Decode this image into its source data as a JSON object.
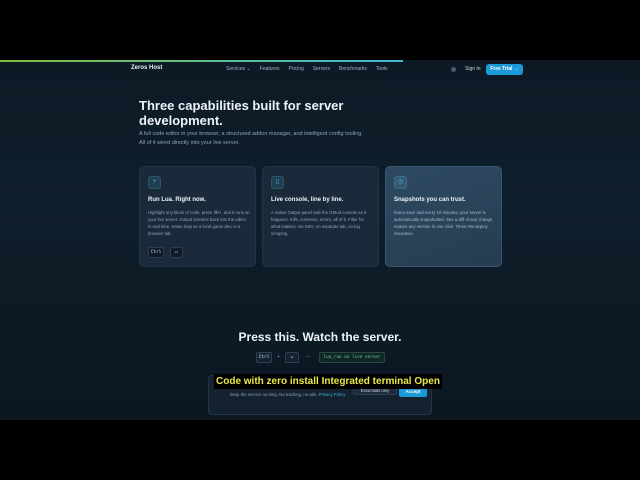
{
  "nav": {
    "logo": "Zeros Host",
    "menu": [
      "Services ⌄",
      "Features",
      "Pricing",
      "Servers",
      "Benchmarks",
      "Tools"
    ],
    "signin": "Sign In",
    "trial": "Free Trial →"
  },
  "hero": {
    "headline": "Three capabilities built for server development.",
    "lead": "A full code editor in your browser, a structured addon manager, and intelligent config tooling. All of it wired directly into your live server."
  },
  "cards": [
    {
      "icon": "code-icon",
      "glyph": "+",
      "title": "Run Lua. Right now.",
      "body": "Highlight any block of code, press ⌘↵, and it runs on your live server. Output streams back into the editor in real time. Same loop as a local game dev, in a browser tab.",
      "keys": [
        "Ctrl",
        "↵"
      ]
    },
    {
      "icon": "console-icon",
      "glyph": "▯",
      "title": "Live console, line by line.",
      "body": "A native Output panel tails the GMod console as it happens. Kills, connects, errors, all of it. Filter for what matters. No SSH, no separate tab, no log scraping."
    },
    {
      "icon": "snapshot-icon",
      "glyph": "◷",
      "title": "Snapshots you can trust.",
      "body": "Every save and every 10 minutes, your server is automatically snapshotted. See a diff of any change, restore any version in one click. Three AM deploy insurance."
    }
  ],
  "demo": {
    "title": "Press this. Watch the server.",
    "key1": "Ctrl",
    "plus": "+",
    "key2": "↵",
    "arrow": "→",
    "result": "lua_run on live server"
  },
  "cookie": {
    "text": "keep the service running. No tracking, no ads.",
    "link": "Privacy Policy",
    "essential": "Essentials only",
    "accept": "Accept"
  },
  "caption": "Code with zero install Integrated terminal Open",
  "colors": {
    "accent": "#1a9ad6",
    "background": "#0f1e2b",
    "caption": "#e9e94a"
  }
}
